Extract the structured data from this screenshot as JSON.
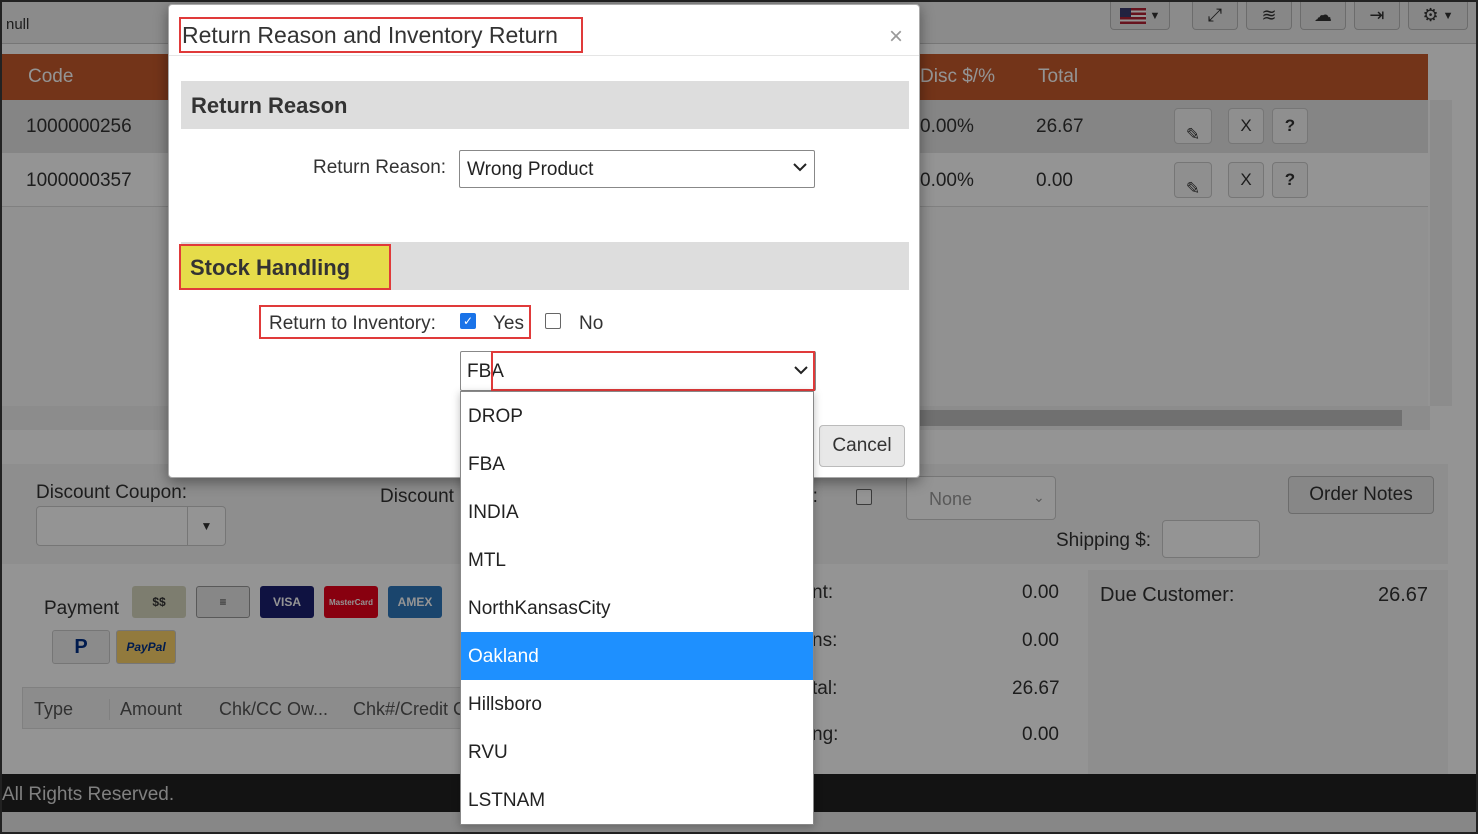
{
  "topbar": {
    "user": "null"
  },
  "grid": {
    "headers": [
      "Code",
      "Disc $/%",
      "Total"
    ],
    "rows": [
      {
        "code": "1000000256",
        "disc": "0.00%",
        "total": "26.67"
      },
      {
        "code": "1000000357",
        "disc": "0.00%",
        "total": "0.00"
      }
    ],
    "row_actions": {
      "remove": "X",
      "help": "?"
    }
  },
  "mid_panel": {
    "discount_coupon_label": "Discount Coupon:",
    "discount_label": "Discount",
    "shipping_select_value": "None",
    "shipping_label": "Shipping $:",
    "order_notes_button": "Order Notes",
    "truncated_label": "p:"
  },
  "payment": {
    "label": "Payment",
    "cards": [
      "VISA",
      "MasterCard",
      "AMEX"
    ],
    "paypal_text": "PayPal",
    "table_headers": [
      "Type",
      "Amount",
      "Chk/CC Ow...",
      "Chk#/Credit C"
    ]
  },
  "totals": {
    "rows": [
      {
        "label": "nt:",
        "value": "0.00"
      },
      {
        "label": "ns:",
        "value": "0.00"
      },
      {
        "label": "tal:",
        "value": "26.67"
      },
      {
        "label": "ng:",
        "value": "0.00"
      }
    ],
    "due_customer_label": "Due Customer:",
    "due_customer_value": "26.67"
  },
  "footer": {
    "text": "All Rights Reserved."
  },
  "modal": {
    "title": "Return Reason and Inventory Return",
    "close": "×",
    "return_reason_section": "Return Reason",
    "return_reason_label": "Return Reason:",
    "return_reason_value": "Wrong Product",
    "stock_section": "Stock Handling",
    "return_to_inventory_label": "Return to Inventory:",
    "yes_label": "Yes",
    "no_label": "No",
    "yes_checked": true,
    "location_value": "FBA",
    "cancel_button": "Cancel"
  },
  "dropdown": {
    "options": [
      "DROP",
      "FBA",
      "INDIA",
      "MTL",
      "NorthKansasCity",
      "Oakland",
      "Hillsboro",
      "RVU",
      "LSTNAM"
    ],
    "highlighted": "Oakland",
    "highlight_color": "#1e90ff"
  },
  "colors": {
    "grid_header": "#c65a2c",
    "annotation_red": "#e03a3a",
    "stock_highlight": "#e6dc4a"
  }
}
